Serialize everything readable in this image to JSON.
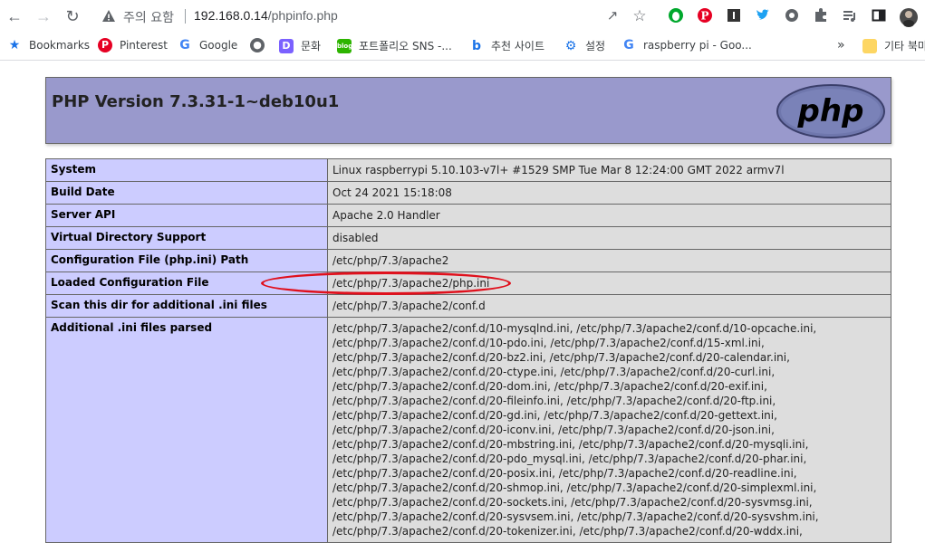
{
  "browser": {
    "insecure_label": "주의 요함",
    "url_host": "192.168.0.14",
    "url_path": "/phpinfo.php"
  },
  "bookmarks": [
    {
      "label": "Bookmarks",
      "icon": "star-icon",
      "color": "#1a73e8"
    },
    {
      "label": "Pinterest",
      "icon": "pinterest-icon",
      "color": "#e60023"
    },
    {
      "label": "Google",
      "icon": "google-icon",
      "color": "#4285f4"
    },
    {
      "label": "",
      "icon": "globe-icon",
      "color": "#5f6368"
    },
    {
      "label": "문화",
      "icon": "daum-icon",
      "color": "#7b61ff"
    },
    {
      "label": "포트폴리오 SNS -...",
      "icon": "blog-icon",
      "color": "#2db400"
    },
    {
      "label": "추천 사이트",
      "icon": "bing-icon",
      "color": "#1a73e8"
    },
    {
      "label": "설정",
      "icon": "gear-icon",
      "color": "#1a73e8"
    },
    {
      "label": "raspberry pi - Goo...",
      "icon": "google-icon",
      "color": "#4285f4"
    }
  ],
  "other_bookmarks": "기타 북마",
  "php": {
    "title": "PHP Version 7.3.31-1~deb10u1",
    "logo_text": "php",
    "rows": [
      {
        "key": "System",
        "value": "Linux raspberrypi 5.10.103-v7l+ #1529 SMP Tue Mar 8 12:24:00 GMT 2022 armv7l"
      },
      {
        "key": "Build Date",
        "value": "Oct 24 2021 15:18:08"
      },
      {
        "key": "Server API",
        "value": "Apache 2.0 Handler"
      },
      {
        "key": "Virtual Directory Support",
        "value": "disabled"
      },
      {
        "key": "Configuration File (php.ini) Path",
        "value": "/etc/php/7.3/apache2"
      },
      {
        "key": "Loaded Configuration File",
        "value": "/etc/php/7.3/apache2/php.ini"
      },
      {
        "key": "Scan this dir for additional .ini files",
        "value": "/etc/php/7.3/apache2/conf.d"
      }
    ],
    "additional_key": "Additional .ini files parsed",
    "additional_lines": [
      "/etc/php/7.3/apache2/conf.d/10-mysqlnd.ini, /etc/php/7.3/apache2/conf.d/10-opcache.ini,",
      "/etc/php/7.3/apache2/conf.d/10-pdo.ini, /etc/php/7.3/apache2/conf.d/15-xml.ini,",
      "/etc/php/7.3/apache2/conf.d/20-bz2.ini, /etc/php/7.3/apache2/conf.d/20-calendar.ini,",
      "/etc/php/7.3/apache2/conf.d/20-ctype.ini, /etc/php/7.3/apache2/conf.d/20-curl.ini,",
      "/etc/php/7.3/apache2/conf.d/20-dom.ini, /etc/php/7.3/apache2/conf.d/20-exif.ini,",
      "/etc/php/7.3/apache2/conf.d/20-fileinfo.ini, /etc/php/7.3/apache2/conf.d/20-ftp.ini,",
      "/etc/php/7.3/apache2/conf.d/20-gd.ini, /etc/php/7.3/apache2/conf.d/20-gettext.ini,",
      "/etc/php/7.3/apache2/conf.d/20-iconv.ini, /etc/php/7.3/apache2/conf.d/20-json.ini,",
      "/etc/php/7.3/apache2/conf.d/20-mbstring.ini, /etc/php/7.3/apache2/conf.d/20-mysqli.ini,",
      "/etc/php/7.3/apache2/conf.d/20-pdo_mysql.ini, /etc/php/7.3/apache2/conf.d/20-phar.ini,",
      "/etc/php/7.3/apache2/conf.d/20-posix.ini, /etc/php/7.3/apache2/conf.d/20-readline.ini,",
      "/etc/php/7.3/apache2/conf.d/20-shmop.ini, /etc/php/7.3/apache2/conf.d/20-simplexml.ini,",
      "/etc/php/7.3/apache2/conf.d/20-sockets.ini, /etc/php/7.3/apache2/conf.d/20-sysvmsg.ini,",
      "/etc/php/7.3/apache2/conf.d/20-sysvsem.ini, /etc/php/7.3/apache2/conf.d/20-sysvshm.ini,",
      "/etc/php/7.3/apache2/conf.d/20-tokenizer.ini, /etc/php/7.3/apache2/conf.d/20-wddx.ini,"
    ]
  },
  "colors": {
    "header_bg": "#9999cc",
    "key_bg": "#ccccff",
    "value_bg": "#dddddd",
    "highlight_oval": "#e0101c"
  }
}
